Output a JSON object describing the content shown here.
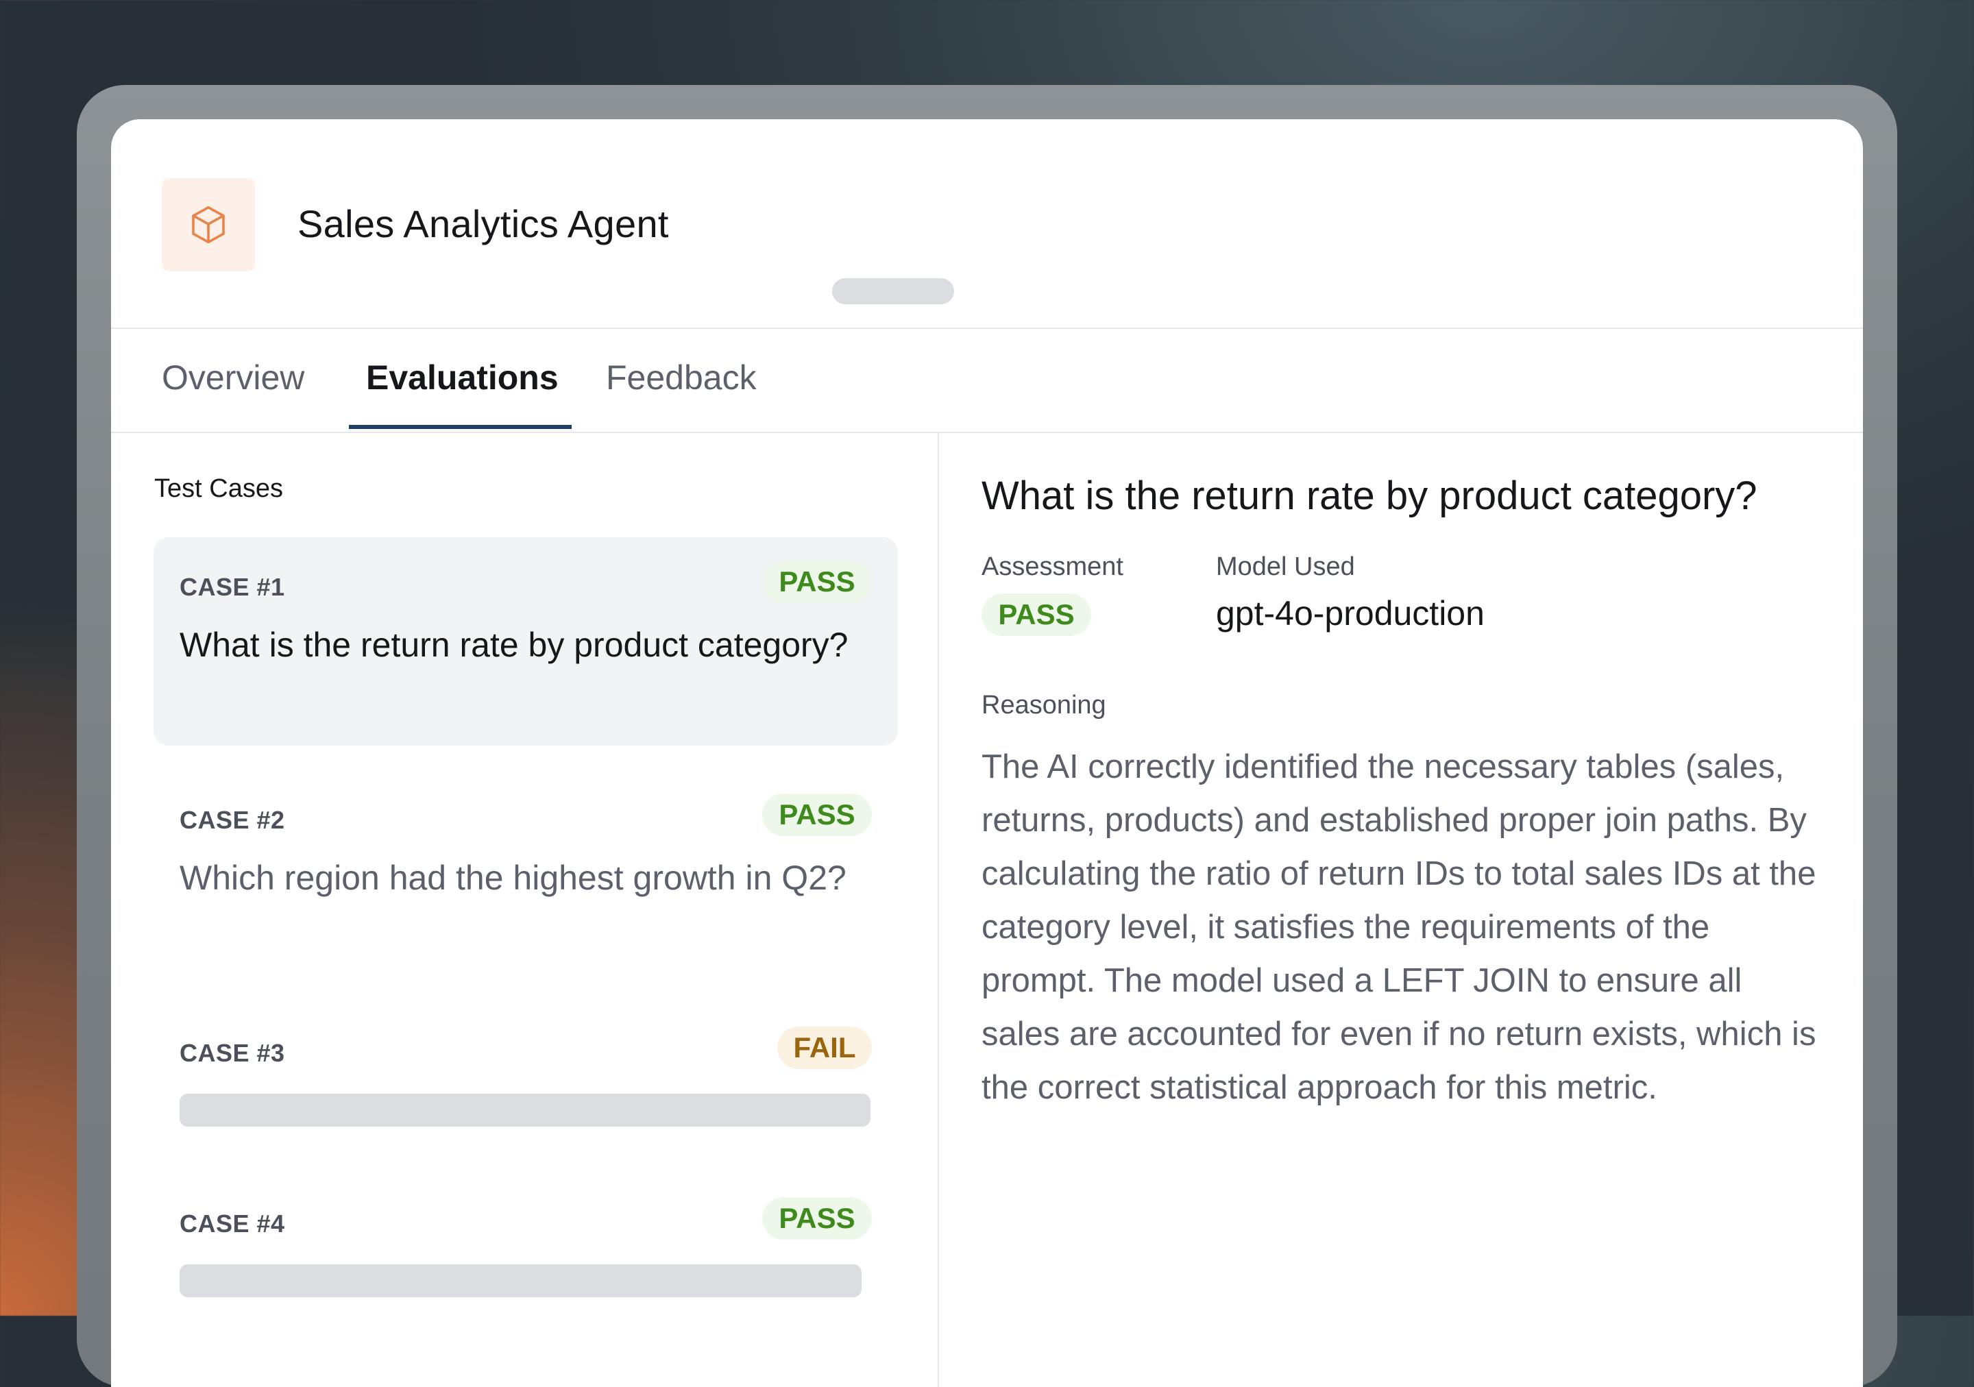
{
  "app": {
    "title": "Sales Analytics Agent",
    "icon": "cube-icon",
    "accent": "#e8834a"
  },
  "tabs": [
    {
      "label": "Overview",
      "active": false
    },
    {
      "label": "Evaluations",
      "active": true
    },
    {
      "label": "Feedback",
      "active": false
    }
  ],
  "test_cases": {
    "label": "Test Cases",
    "items": [
      {
        "id": "CASE #1",
        "status": "PASS",
        "question": "What is the return rate by product category?",
        "selected": true
      },
      {
        "id": "CASE #2",
        "status": "PASS",
        "question": "Which region had the highest growth in Q2?",
        "selected": false
      },
      {
        "id": "CASE #3",
        "status": "FAIL",
        "question": "",
        "selected": false
      },
      {
        "id": "CASE #4",
        "status": "PASS",
        "question": "",
        "selected": false
      }
    ]
  },
  "detail": {
    "title": "What is the return rate by product category?",
    "assessment_label": "Assessment",
    "assessment_value": "PASS",
    "model_label": "Model Used",
    "model_value": "gpt-4o-production",
    "reasoning_label": "Reasoning",
    "reasoning_text": "The AI correctly identified the necessary tables (sales, returns, products) and established proper join paths. By calculating the ratio of return IDs to total sales IDs at the category level, it satisfies the requirements of the prompt. The model used a LEFT JOIN to ensure all sales are accounted for even if no return exists, which is the correct statistical approach for this metric."
  },
  "colors": {
    "pass": "#3f8a1c",
    "fail": "#99650e",
    "tab_underline": "#1f3f66"
  }
}
